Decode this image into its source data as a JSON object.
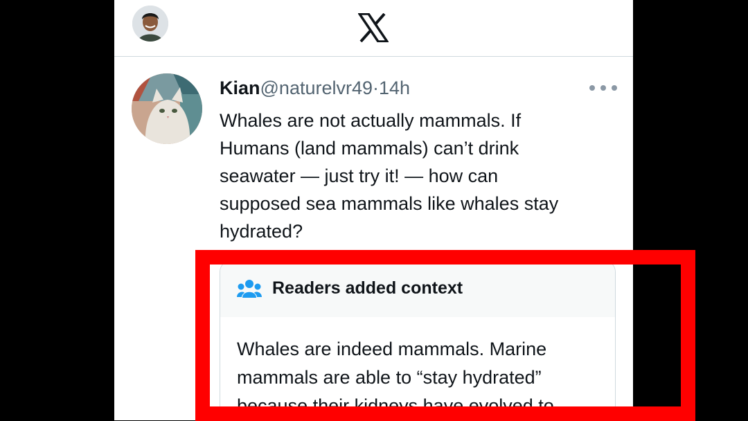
{
  "app": {
    "logo": "x-logo"
  },
  "header": {
    "avatar_icon": "user-avatar"
  },
  "tweet": {
    "author_name": "Kian",
    "handle": "@naturelvr49",
    "separator": "·",
    "time": "14h",
    "more_icon": "more-dots-icon",
    "text_lines": [
      "Whales are not actually mammals. If",
      "Humans (land mammals) can’t drink",
      "seawater — just try it! — how can",
      "supposed sea mammals like whales stay",
      "hydrated?"
    ]
  },
  "context": {
    "icon": "people-icon",
    "title": "Readers added context",
    "body_lines": [
      "Whales are indeed mammals. Marine",
      "mammals are able to “stay hydrated”",
      "because their kidneys have evolved to"
    ]
  },
  "colors": {
    "highlight": "#ff0000",
    "accent": "#1d9bf0",
    "text": "#0f1419",
    "muted": "#536471"
  }
}
